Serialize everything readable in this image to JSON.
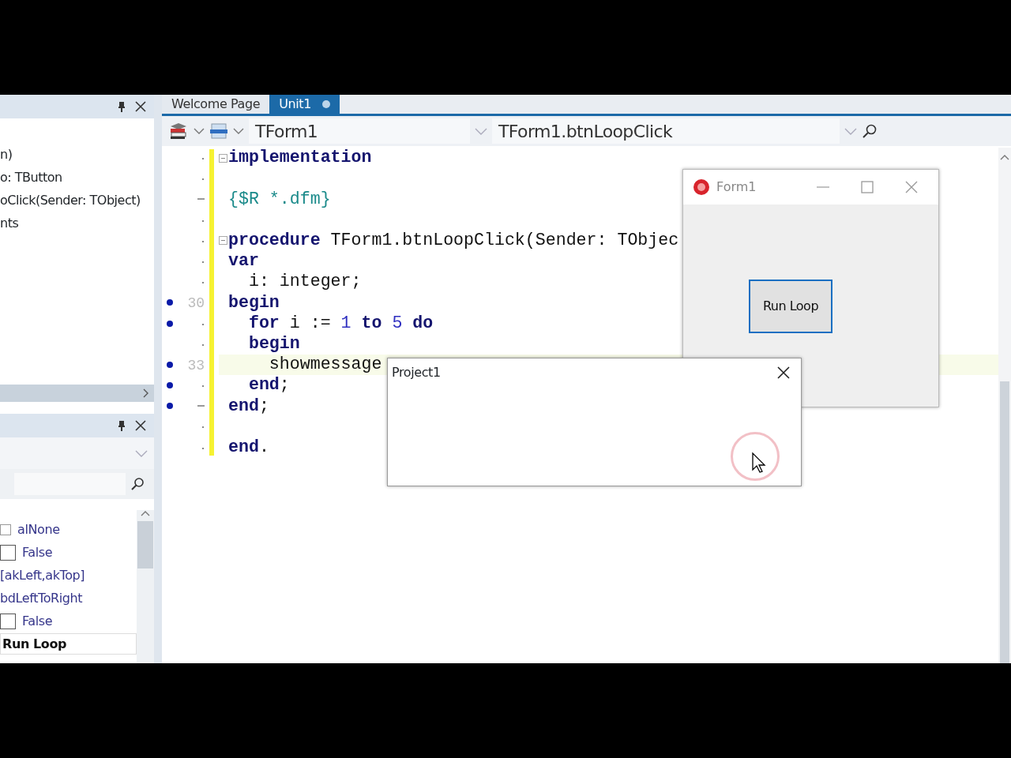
{
  "structure_panel": {
    "items": [
      {
        "text": "n)"
      },
      {
        "text": "o: TButton"
      },
      {
        "text": "oClick(Sender: TObject)"
      },
      {
        "text": "nts"
      }
    ]
  },
  "object_inspector": {
    "properties": [
      {
        "kind": "enum",
        "value": "alNone"
      },
      {
        "kind": "checkbox",
        "checked": false,
        "value": "False"
      },
      {
        "kind": "text",
        "value": "[akLeft,akTop]"
      },
      {
        "kind": "text",
        "value": "bdLeftToRight"
      },
      {
        "kind": "checkbox",
        "checked": false,
        "value": "False"
      },
      {
        "kind": "edit",
        "value": "Run Loop"
      }
    ]
  },
  "tabs": [
    {
      "label": "Welcome Page",
      "selected": false,
      "modified": false
    },
    {
      "label": "Unit1",
      "selected": true,
      "modified": true
    }
  ],
  "editor_toolbar": {
    "class_combo": "TForm1",
    "method_combo": "TForm1.btnLoopClick"
  },
  "code_lines": [
    {
      "kind": "dot",
      "fold": true,
      "breakpoint": false,
      "tokens": [
        {
          "kind": "keyword",
          "t": "implementation"
        }
      ]
    },
    {
      "kind": "dot",
      "fold": false,
      "breakpoint": false
    },
    {
      "kind": "dash",
      "fold": false,
      "breakpoint": false,
      "tokens": [
        {
          "kind": "directive",
          "t": "{$R *.dfm}"
        }
      ]
    },
    {
      "kind": "dot",
      "fold": false,
      "breakpoint": false
    },
    {
      "kind": "dot",
      "fold": true,
      "breakpoint": false,
      "tokens": [
        {
          "kind": "keyword",
          "t": "procedure"
        },
        {
          "kind": "plain",
          "t": " TForm1.btnLoopClick(Sender: TObjec"
        }
      ]
    },
    {
      "kind": "dot",
      "fold": false,
      "breakpoint": false,
      "tokens": [
        {
          "kind": "keyword",
          "t": "var"
        }
      ]
    },
    {
      "kind": "dot",
      "fold": false,
      "breakpoint": false,
      "tokens": [
        {
          "kind": "plain",
          "t": "  i: integer;"
        }
      ]
    },
    {
      "kind": "number",
      "number": "30",
      "fold": false,
      "breakpoint": true,
      "tokens": [
        {
          "kind": "keyword",
          "t": "begin"
        }
      ]
    },
    {
      "kind": "dot",
      "fold": false,
      "breakpoint": true,
      "tokens": [
        {
          "kind": "keyword",
          "t": "  for"
        },
        {
          "kind": "plain",
          "t": " i := "
        },
        {
          "kind": "number",
          "t": "1"
        },
        {
          "kind": "keyword",
          "t": " to"
        },
        {
          "kind": "number",
          "t": " 5"
        },
        {
          "kind": "keyword",
          "t": " do"
        }
      ]
    },
    {
      "kind": "dot",
      "fold": false,
      "breakpoint": false,
      "tokens": [
        {
          "kind": "keyword",
          "t": "  begin"
        }
      ]
    },
    {
      "kind": "number",
      "number": "33",
      "fold": false,
      "breakpoint": true,
      "highlighted": true,
      "tokens": [
        {
          "kind": "plain",
          "t": "    showmessage"
        }
      ]
    },
    {
      "kind": "dot",
      "fold": false,
      "breakpoint": true,
      "tokens": [
        {
          "kind": "keyword",
          "t": "  end"
        },
        {
          "kind": "plain",
          "t": ";"
        }
      ]
    },
    {
      "kind": "dash",
      "fold": false,
      "breakpoint": true,
      "tokens": [
        {
          "kind": "keyword",
          "t": "end"
        },
        {
          "kind": "plain",
          "t": ";"
        }
      ]
    },
    {
      "kind": "dot",
      "fold": false,
      "breakpoint": false
    },
    {
      "kind": "dot",
      "fold": false,
      "breakpoint": false,
      "tokens": [
        {
          "kind": "keyword",
          "t": "end"
        },
        {
          "kind": "plain",
          "t": "."
        }
      ]
    }
  ],
  "form_window": {
    "title": "Form1",
    "button": "Run Loop"
  },
  "message_dialog": {
    "title": "Project1"
  }
}
